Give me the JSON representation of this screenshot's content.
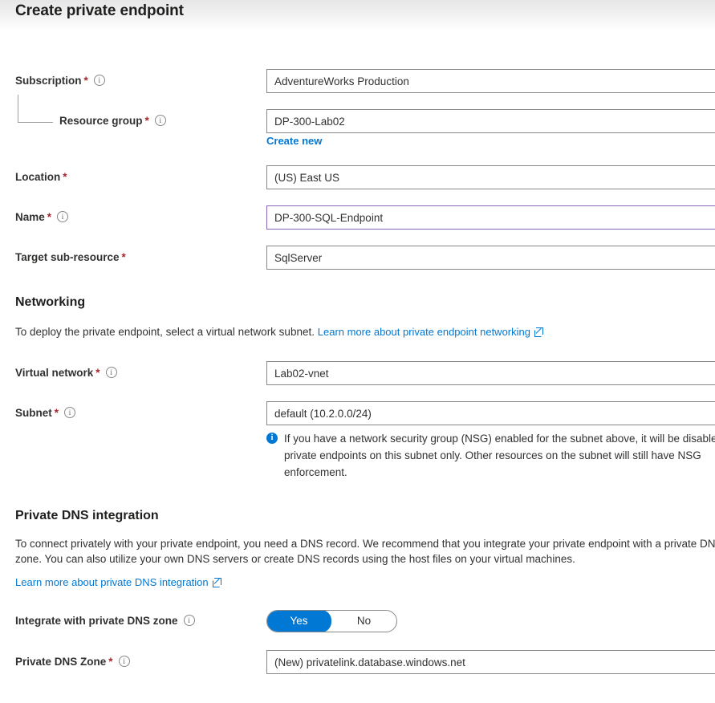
{
  "blade": {
    "title": "Create private endpoint"
  },
  "basics": {
    "subscription": {
      "label": "Subscription",
      "required": "*",
      "info_icon": "info-circle-icon",
      "value": "AdventureWorks Production"
    },
    "resource_group": {
      "label": "Resource group",
      "required": "*",
      "info_icon": "info-circle-icon",
      "value": "DP-300-Lab02",
      "create_new_label": "Create new"
    },
    "location": {
      "label": "Location",
      "required": "*",
      "value": "(US) East US"
    },
    "name": {
      "label": "Name",
      "required": "*",
      "info_icon": "info-circle-icon",
      "value": "DP-300-SQL-Endpoint",
      "border_color": "#8764b8"
    },
    "target_sub_resource": {
      "label": "Target sub-resource",
      "required": "*",
      "value": "SqlServer"
    }
  },
  "networking": {
    "heading": "Networking",
    "description": "To deploy the private endpoint, select a virtual network subnet.",
    "learn_more_label": "Learn more about private endpoint networking",
    "learn_more_icon": "external-link-icon",
    "virtual_network": {
      "label": "Virtual network",
      "required": "*",
      "info_icon": "info-circle-icon",
      "value": "Lab02-vnet"
    },
    "subnet": {
      "label": "Subnet",
      "required": "*",
      "info_icon": "info-circle-icon",
      "value": "default (10.2.0.0/24)"
    },
    "nsg_notice": {
      "icon": "info-filled-icon",
      "text": "If you have a network security group (NSG) enabled for the subnet above, it will be disabled for private endpoints on this subnet only. Other resources on the subnet will still have NSG enforcement."
    }
  },
  "private_dns": {
    "heading": "Private DNS integration",
    "description": "To connect privately with your private endpoint, you need a DNS record. We recommend that you integrate your private endpoint with a private DNS zone. You can also utilize your own DNS servers or create DNS records using the host files on your virtual machines.",
    "learn_more_label": "Learn more about private DNS integration",
    "learn_more_icon": "external-link-icon",
    "integrate_toggle": {
      "label": "Integrate with private DNS zone",
      "info_icon": "info-circle-icon",
      "yes_label": "Yes",
      "no_label": "No",
      "selected": "Yes",
      "accent_color": "#0078d4"
    },
    "zone": {
      "label": "Private DNS Zone",
      "required": "*",
      "info_icon": "info-circle-icon",
      "value": "(New) privatelink.database.windows.net"
    }
  },
  "colors": {
    "accent": "#0078d4",
    "required_asterisk": "#a4262c",
    "focus_border": "#8764b8",
    "field_border": "#8a8886",
    "text": "#323130"
  }
}
